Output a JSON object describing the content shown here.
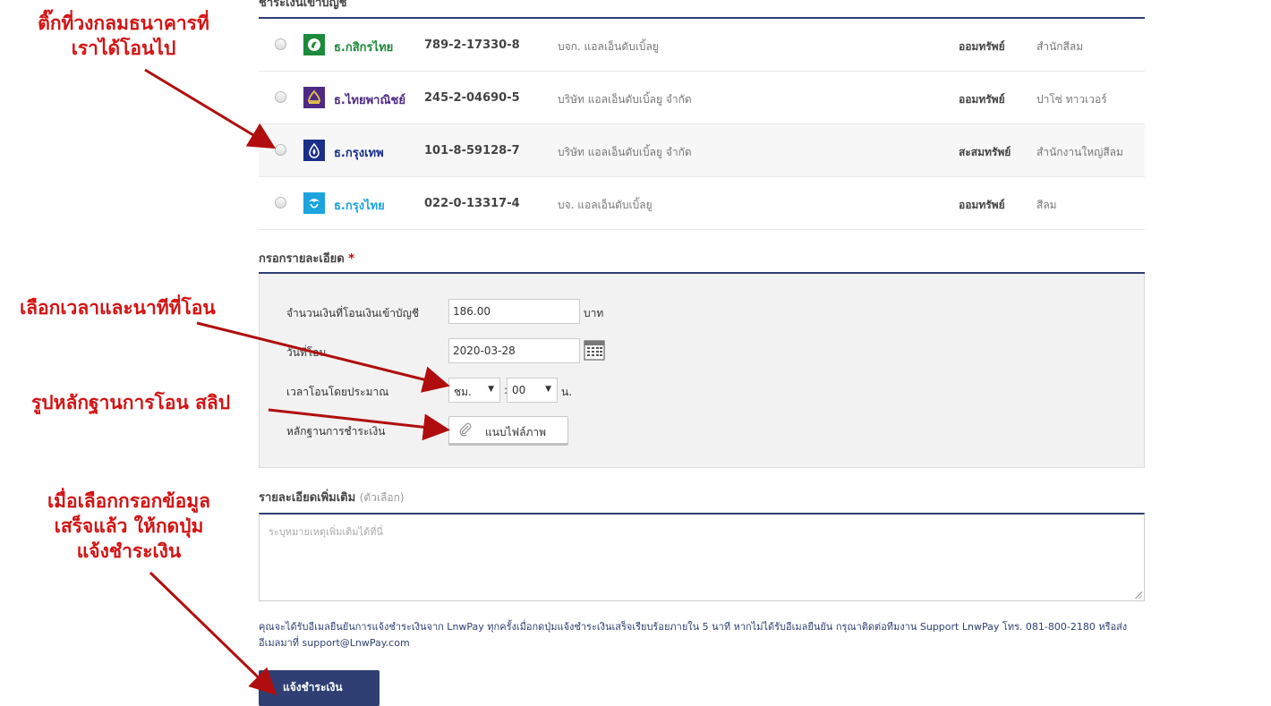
{
  "section_bank_title": "ชำระเงินเข้าบัญชี",
  "banks": [
    {
      "name": "ธ.กสิกรไทย",
      "name_color": "#1c8a3a",
      "logo_bg": "#1c8a3a",
      "account": "789-2-17330-8",
      "owner": "บจก. แอลเอ็นดับเบิ้ลยู",
      "type": "ออมทรัพย์",
      "branch": "สำนักสีลม"
    },
    {
      "name": "ธ.ไทยพาณิชย์",
      "name_color": "#4e2a84",
      "logo_bg": "#4e2a84",
      "account": "245-2-04690-5",
      "owner": "บริษัท แอลเอ็นดับเบิ้ลยู จำกัด",
      "type": "ออมทรัพย์",
      "branch": "ปาโซ่ ทาวเวอร์"
    },
    {
      "name": "ธ.กรุงเทพ",
      "name_color": "#1a2f8a",
      "logo_bg": "#1a2f8a",
      "account": "101-8-59128-7",
      "owner": "บริษัท แอลเอ็นดับเบิ้ลยู จำกัด",
      "type": "สะสมทรัพย์",
      "branch": "สำนักงานใหญ่สีลม"
    },
    {
      "name": "ธ.กรุงไทย",
      "name_color": "#1ba4de",
      "logo_bg": "#1ba4de",
      "account": "022-0-13317-4",
      "owner": "บจ. แอลเอ็นดับเบิ้ลยู",
      "type": "ออมทรัพย์",
      "branch": "สีลม"
    }
  ],
  "details": {
    "title": "กรอกรายละเอียด",
    "required_mark": "*",
    "amount_label": "จำนวนเงินที่โอนเงินเข้าบัญชี",
    "amount_value": "186.00",
    "amount_unit": "บาท",
    "date_label": "วันที่โอน",
    "date_value": "2020-03-28",
    "time_label": "เวลาโอนโดยประมาณ",
    "hour_value": "ชม.",
    "time_sep": ":",
    "minute_value": "00",
    "time_unit": "น.",
    "proof_label": "หลักฐานการชำระเงิน",
    "attach_label": "แนบไฟล์ภาพ"
  },
  "extra": {
    "title": "รายละเอียดเพิ่มเติม",
    "optional": "(ตัวเลือก)",
    "placeholder": "ระบุหมายเหตุเพิ่มเติมได้ที่นี่"
  },
  "note": "คุณจะได้รับอีเมลยืนยันการแจ้งชำระเงินจาก LnwPay ทุกครั้งเมื่อกดปุ่มแจ้งชำระเงินเสร็จเรียบร้อยภายใน 5 นาที หากไม่ได้รับอีเมลยืนยัน กรุณาติดต่อทีมงาน Support LnwPay โทร. 081-800-2180 หรือส่งอีเมลมาที่ support@LnwPay.com",
  "submit_label": "แจ้งชำระเงิน",
  "annotations": {
    "a1_line1": "ติ๊กที่วงกลมธนาคารที่",
    "a1_line2": "เราได้โอนไป",
    "a2": "เลือกเวลาและนาทีที่โอน",
    "a3": "รูปหลักฐานการโอน สลิป",
    "a4_line1": "เมื่อเลือกกรอกข้อมูล",
    "a4_line2": "เสร็จแล้ว ให้กดปุ่ม",
    "a4_line3": "แจ้งชำระเงิน"
  },
  "colors": {
    "accent": "#2f3f73",
    "annotation": "#d31313"
  }
}
